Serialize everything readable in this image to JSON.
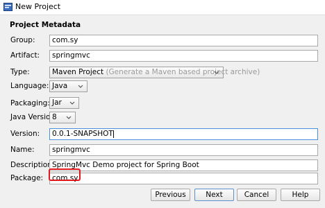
{
  "window": {
    "title": "New Project"
  },
  "section": {
    "heading": "Project Metadata"
  },
  "fields": {
    "group": {
      "label": "Group:",
      "value": "com.sy"
    },
    "artifact": {
      "label": "Artifact:",
      "value": "springmvc"
    },
    "type": {
      "label": "Type:",
      "value": "Maven Project",
      "hint": "(Generate a Maven based project archive)"
    },
    "language": {
      "label": "Language:",
      "value": "Java"
    },
    "packaging": {
      "label": "Packaging:",
      "value": "Jar"
    },
    "java_version": {
      "label": "Java Version:",
      "value": "8"
    },
    "version": {
      "label": "Version:",
      "value": "0.0.1-SNAPSHOT"
    },
    "name": {
      "label": "Name:",
      "value": "springmvc"
    },
    "description": {
      "label": "Description:",
      "value": "SpringMvc Demo project for Spring Boot"
    },
    "package": {
      "label": "Package:",
      "value": "com.sy"
    }
  },
  "buttons": {
    "previous": "Previous",
    "next": "Next",
    "cancel": "Cancel",
    "help": "Help"
  },
  "colors": {
    "highlight": "#e0191d",
    "focus_border": "#4a90d9"
  },
  "icons": {
    "window": "intellij-project-icon",
    "dropdown": "chevron-down-icon"
  }
}
